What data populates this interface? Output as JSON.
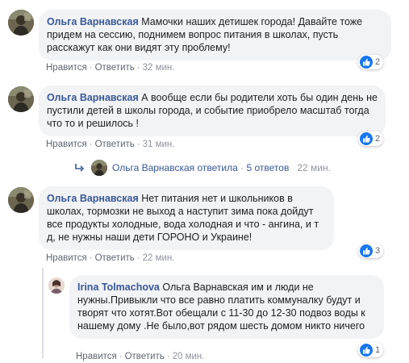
{
  "comments": [
    {
      "author": "Ольга Варнавская",
      "text": "Мамочки наших детишек города! Давайте тоже придем на сессию, поднимем вопрос питания в школах, пусть расскажут как они видят эту проблему!",
      "like_label": "Нравится",
      "reply_label": "Ответить",
      "time": "32 мин.",
      "reaction_count": "2"
    },
    {
      "author": "Ольга Варнавская",
      "text": "А вообще если бы родители хоть бы один день не пустили детей в школы города, и событие приобрело масштаб тогда что то и решилось !",
      "like_label": "Нравится",
      "reply_label": "Ответить",
      "time": "31 мин.",
      "reaction_count": "2"
    },
    {
      "author": "Ольга Варнавская",
      "text": "Нет питания нет и школьников в школах, тормозки не выход а наступит зима пока дойдут все продукты холодные, вода холодная и что - ангина, и т д, не нужны наши дети ГОРОНО и Украине!",
      "like_label": "Нравится",
      "reply_label": "Ответить",
      "time": "22 мин.",
      "reaction_count": "3"
    }
  ],
  "reply_summary": {
    "author": "Ольга Варнавская",
    "verb": "ответила",
    "separator": "·",
    "count": "5 ответов",
    "time": "22 мин."
  },
  "reply": {
    "author": "Irina Tolmachova",
    "text": "Ольга Варнавская им и люди не нужны.Привыкли что все равно платить коммуналку будут и творят что хотят.Вот обещали с 11-30 до 12-30 подвоз воды к нашему дому .Не было,вот рядом шесть домом никто ничего",
    "like_label": "Нравится",
    "reply_label": "Ответить",
    "time": "20 мин.",
    "reaction_count": "1"
  },
  "separator": "·",
  "icons": {
    "avatar_main": "profile-photo-icon",
    "avatar_reply": "profile-photo-icon",
    "reaction": "like-icon",
    "reply_arrow": "reply-arrow-icon"
  },
  "colors": {
    "link": "#385898",
    "bubble": "#f2f3f5",
    "meta": "#606770",
    "like_blue": "#1877f2"
  }
}
